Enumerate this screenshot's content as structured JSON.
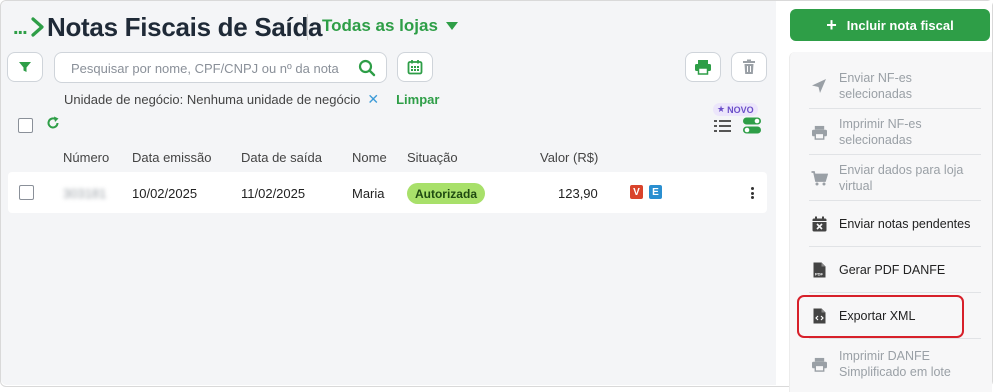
{
  "header": {
    "breadcrumb_dots": "...",
    "title": "Notas Fiscais de Saída",
    "store_selector": "Todas as lojas"
  },
  "toolbar": {
    "search_placeholder": "Pesquisar por nome, CPF/CNPJ ou nº da nota"
  },
  "filter": {
    "text": "Unidade de negócio: Nenhuma unidade de negócio",
    "remove_symbol": "✕",
    "clear_label": "Limpar"
  },
  "badge_new": "NOVO",
  "table": {
    "columns": [
      "Número",
      "Data emissão",
      "Data de saída",
      "Nome",
      "Situação",
      "Valor (R$)"
    ],
    "rows": [
      {
        "numero": "303181",
        "data_emissao": "10/02/2025",
        "data_saida": "11/02/2025",
        "nome": "Maria",
        "situacao": "Autorizada",
        "valor": "123,90",
        "tag_v": "V",
        "tag_e": "E"
      }
    ]
  },
  "sidebar": {
    "primary_button": "Incluir nota fiscal",
    "actions": [
      {
        "label": "Enviar NF-es selecionadas",
        "icon": "send-icon",
        "enabled": false
      },
      {
        "label": "Imprimir NF-es selecionadas",
        "icon": "printer-icon",
        "enabled": false
      },
      {
        "label": "Enviar dados para loja virtual",
        "icon": "cart-icon",
        "enabled": false
      },
      {
        "label": "Enviar notas pendentes",
        "icon": "calendar-x-icon",
        "enabled": true
      },
      {
        "label": "Gerar PDF DANFE",
        "icon": "pdf-file-icon",
        "enabled": true
      },
      {
        "label": "Exportar XML",
        "icon": "code-file-icon",
        "enabled": true
      },
      {
        "label": "Imprimir DANFE Simplificado em lote",
        "icon": "printer-icon",
        "enabled": false
      }
    ]
  },
  "colors": {
    "brand_green": "#2e9e47",
    "status_authorized": "#a8e06a",
    "tag_v": "#d9432b",
    "tag_e": "#2a8fd0",
    "highlight_red": "#d7202a",
    "new_badge": "#6b4fc9"
  }
}
